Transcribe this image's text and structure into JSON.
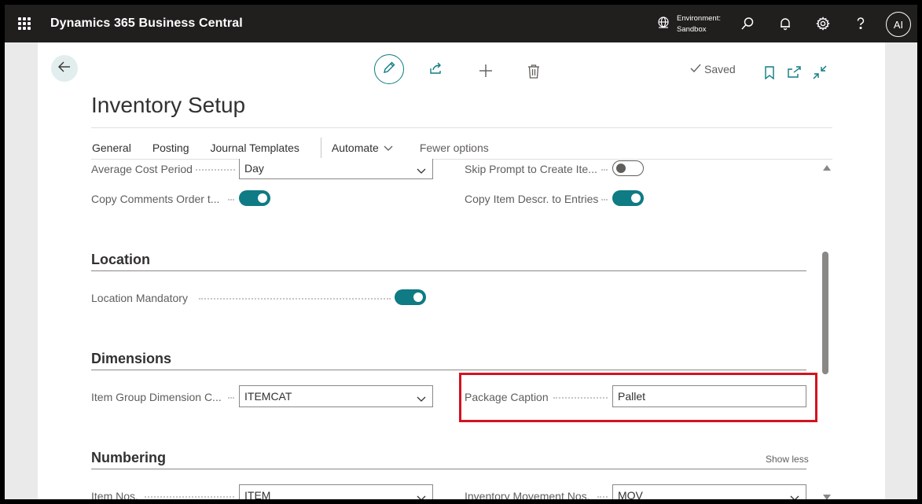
{
  "topbar": {
    "app_title": "Dynamics 365 Business Central",
    "env_label": "Environment:",
    "env_name": "Sandbox",
    "avatar": "AI",
    "icons": [
      "waffle-icon",
      "globe-icon",
      "search-icon",
      "bell-icon",
      "gear-icon",
      "help-icon"
    ]
  },
  "toolbar": {
    "status": "Saved",
    "icons": [
      "back-arrow-icon",
      "edit-pencil-icon",
      "share-icon",
      "add-icon",
      "delete-icon",
      "bookmark-icon",
      "open-new-window-icon",
      "collapse-icon"
    ]
  },
  "page": {
    "title": "Inventory Setup",
    "tabs": [
      "General",
      "Posting",
      "Journal Templates"
    ],
    "automate": "Automate",
    "fewer_options": "Fewer options"
  },
  "fields": {
    "avg_cost_period_label": "Average Cost Period",
    "avg_cost_period_value": "Day",
    "skip_prompt_label": "Skip Prompt to Create Ite...",
    "skip_prompt_on": false,
    "copy_comments_label": "Copy Comments Order t...",
    "copy_comments_on": true,
    "copy_item_descr_label": "Copy Item Descr. to Entries",
    "copy_item_descr_on": true
  },
  "location": {
    "heading": "Location",
    "mandatory_label": "Location Mandatory",
    "mandatory_on": true
  },
  "dimensions": {
    "heading": "Dimensions",
    "item_group_label": "Item Group Dimension C...",
    "item_group_value": "ITEMCAT",
    "package_caption_label": "Package Caption",
    "package_caption_value": "Pallet"
  },
  "numbering": {
    "heading": "Numbering",
    "show_less": "Show less",
    "item_nos_label": "Item Nos.",
    "item_nos_value": "ITEM",
    "inv_movement_label": "Inventory Movement Nos.",
    "inv_movement_value": "MOV"
  },
  "colors": {
    "topbar": "#201f1e",
    "accent": "#0f7b84",
    "highlight": "#d4121f",
    "gutter": "#eaeaea"
  }
}
